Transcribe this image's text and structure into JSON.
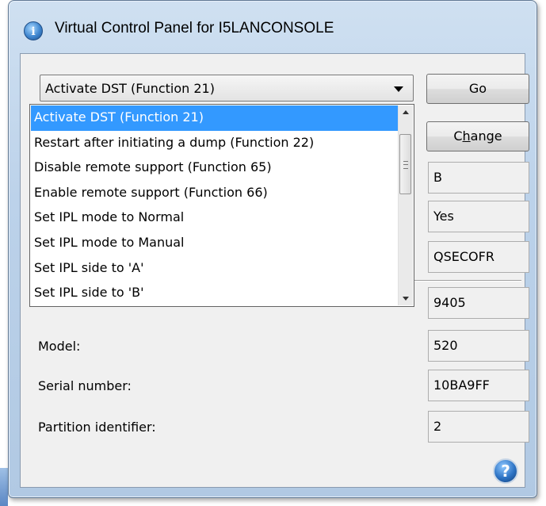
{
  "window": {
    "title": "Virtual Control Panel for I5LANCONSOLE",
    "icon": "info-icon"
  },
  "combo": {
    "selected": "Activate DST (Function 21)"
  },
  "buttons": {
    "go": "Go",
    "change": "Change",
    "change_mnemonic": "h"
  },
  "dropdown": {
    "items": [
      "Activate DST (Function 21)",
      "Restart after initiating a dump (Function 22)",
      "Disable remote support (Function 65)",
      "Enable remote support (Function 66)",
      "Set IPL mode to Normal",
      "Set IPL mode to Manual",
      "Set IPL side to 'A'",
      "Set IPL side to 'B'"
    ],
    "highlighted_index": 0
  },
  "fields": {
    "ipl_side_value": "B",
    "ipl_flag_value": "Yes",
    "user_value": "QSECOFR",
    "type_value": "9405",
    "model_label": "Model:",
    "model_value": "520",
    "serial_label": "Serial number:",
    "serial_value": "10BA9FF",
    "partition_label": "Partition identifier:",
    "partition_value": "2"
  },
  "help": {
    "glyph": "?"
  },
  "colors": {
    "selection": "#3399ff",
    "client_bg": "#f0f0f0",
    "frame": "#bcd2ea"
  }
}
